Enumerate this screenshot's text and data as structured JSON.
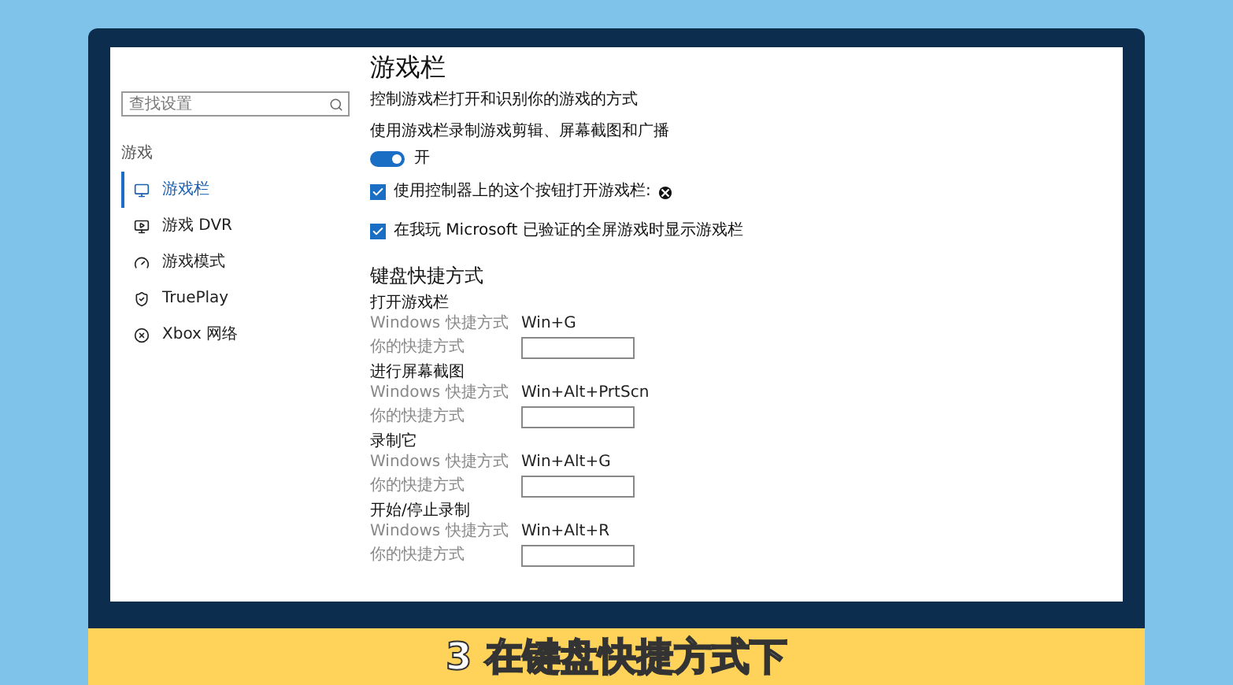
{
  "sidebar": {
    "search": {
      "placeholder": "查找设置"
    },
    "section": "游戏",
    "items": [
      {
        "label": "游戏栏",
        "selected": true
      },
      {
        "label": "游戏 DVR",
        "selected": false
      },
      {
        "label": "游戏模式",
        "selected": false
      },
      {
        "label": "TruePlay",
        "selected": false
      },
      {
        "label": "Xbox 网络",
        "selected": false
      }
    ]
  },
  "main": {
    "title": "游戏栏",
    "description": "控制游戏栏打开和识别你的游戏的方式",
    "toggle": {
      "label": "使用游戏栏录制游戏剪辑、屏幕截图和广播",
      "on": true,
      "state_label": "开"
    },
    "checkboxes": [
      {
        "label": "使用控制器上的这个按钮打开游戏栏:",
        "checked": true,
        "kind": "xbox"
      },
      {
        "label": "在我玩 Microsoft 已验证的全屏游戏时显示游戏栏",
        "checked": true,
        "kind": "plain"
      }
    ],
    "shortcuts_heading": "键盘快捷方式",
    "shortcuts": [
      {
        "title": "打开游戏栏",
        "windows_label": "Windows 快捷方式",
        "windows_value": "Win+G",
        "yours_label": "你的快捷方式"
      },
      {
        "title": "进行屏幕截图",
        "windows_label": "Windows 快捷方式",
        "windows_value": "Win+Alt+PrtScn",
        "yours_label": "你的快捷方式"
      },
      {
        "title": "录制它",
        "windows_label": "Windows 快捷方式",
        "windows_value": "Win+Alt+G",
        "yours_label": "你的快捷方式"
      },
      {
        "title": "开始/停止录制",
        "windows_label": "Windows 快捷方式",
        "windows_value": "Win+Alt+R",
        "yours_label": "你的快捷方式"
      }
    ]
  },
  "caption": "3 在键盘快捷方式下"
}
